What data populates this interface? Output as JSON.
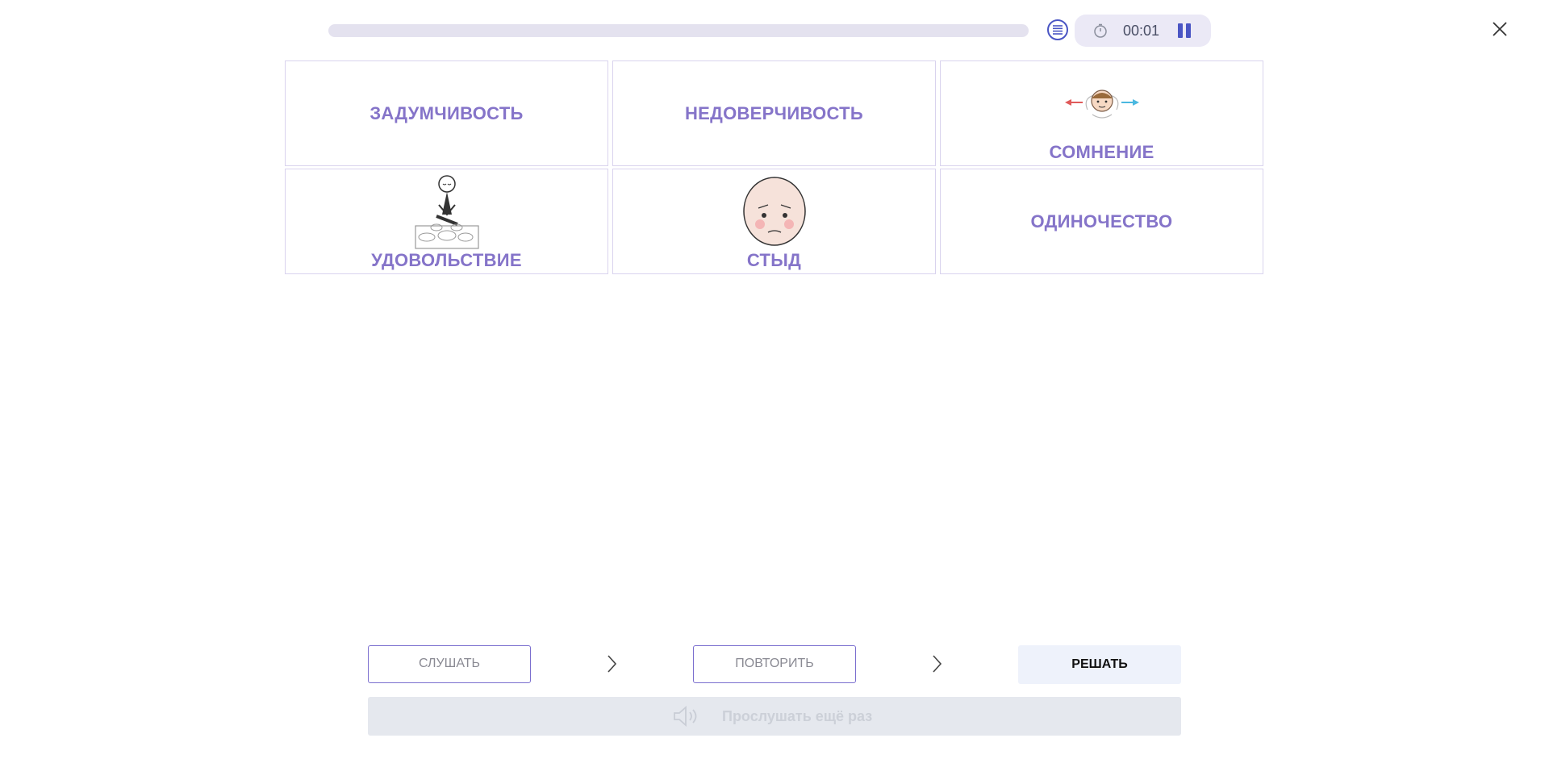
{
  "header": {
    "progress_fraction": 0.0,
    "timer": "00:01",
    "icons": {
      "list": "list-icon",
      "timer": "stopwatch-icon",
      "pause": "pause-icon",
      "close": "close-icon"
    }
  },
  "cards": [
    {
      "label": "ЗАДУМЧИВОСТЬ",
      "has_picture": false
    },
    {
      "label": "НЕДОВЕРЧИВОСТЬ",
      "has_picture": false
    },
    {
      "label": "СОМНЕНИЕ",
      "has_picture": true,
      "picture": "doubt-figure-icon"
    },
    {
      "label": "УДОВОЛЬСТВИЕ",
      "has_picture": true,
      "picture": "enjoyment-figure-icon"
    },
    {
      "label": "СТЫД",
      "has_picture": true,
      "picture": "shame-face-icon"
    },
    {
      "label": "ОДИНОЧЕСТВО",
      "has_picture": false
    }
  ],
  "steps": {
    "listen_label": "СЛУШАТЬ",
    "repeat_label": "ПОВТОРИТЬ",
    "solve_label": "РЕШАТЬ"
  },
  "listen_again": {
    "label": "Прослушать ещё раз",
    "icon": "speaker-icon",
    "enabled": false
  },
  "colors": {
    "accent": "#7b6fcf",
    "card_label": "#8574c9",
    "card_border": "#d9d3ee",
    "progress_track": "#e4e2ef",
    "timer_bg": "#ebe9f6",
    "solve_bg": "#eef2fb",
    "disabled_bg": "#e5e8ee"
  }
}
